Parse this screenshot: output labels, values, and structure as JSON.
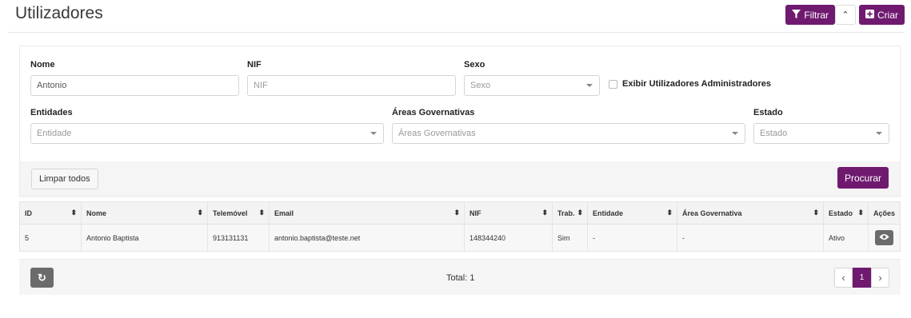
{
  "page": {
    "title": "Utilizadores"
  },
  "actions": {
    "filter_label": "Filtrar",
    "create_label": "Criar",
    "collapse_glyph": "⌃"
  },
  "filters": {
    "name": {
      "label": "Nome",
      "value": "Antonio"
    },
    "nif": {
      "label": "NIF",
      "placeholder": "NIF"
    },
    "sex": {
      "label": "Sexo",
      "placeholder": "Sexo"
    },
    "admin_checkbox_label": "Exibir Utilizadores Administradores",
    "entities": {
      "label": "Entidades",
      "placeholder": "Entidade"
    },
    "areas": {
      "label": "Áreas Governativas",
      "placeholder": "Áreas Governativas"
    },
    "state": {
      "label": "Estado",
      "placeholder": "Estado"
    },
    "clear_label": "Limpar todos",
    "search_label": "Procurar"
  },
  "table": {
    "headers": [
      "ID",
      "Nome",
      "Telemóvel",
      "Email",
      "NIF",
      "Trab.",
      "Entidade",
      "Área Governativa",
      "Estado",
      "Ações"
    ],
    "rows": [
      [
        "5",
        "Antonio Baptista",
        "913131131",
        "antonio.baptista@teste.net",
        "148344240",
        "Sim",
        "-",
        "-",
        "Ativo"
      ]
    ]
  },
  "footer": {
    "total": "Total: 1",
    "current_page": "1",
    "prev_glyph": "‹",
    "next_glyph": "›",
    "refresh_glyph": "↻"
  },
  "icons": [
    "filter-icon",
    "plus-square-icon",
    "chevron-up-icon",
    "eye-icon",
    "refresh-icon",
    "sort-icon"
  ],
  "colors": {
    "accent": "#6f1a6f",
    "muted_button": "#6b6b6b"
  }
}
